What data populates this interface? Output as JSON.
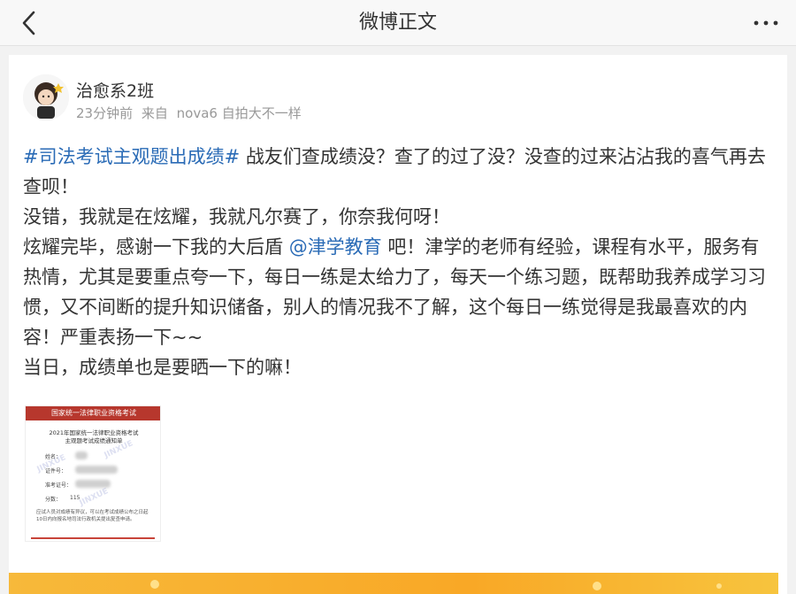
{
  "nav": {
    "title": "微博正文",
    "back_icon": "chevron-left-icon",
    "more_icon": "more-dots-icon"
  },
  "post": {
    "author": "治愈系2班",
    "time": "23分钟前",
    "source_prefix": "来自",
    "device": "nova6 自拍大不一样",
    "hashtag": "#司法考试主观题出成绩#",
    "line1_rest": " 战友们查成绩没？查了的过了没？没查的过来沾沾我的喜气再去查呗！",
    "line2": "没错，我就是在炫耀，我就凡尔赛了，你奈我何呀！",
    "line3_pre": "炫耀完毕，感谢一下我的大后盾 ",
    "mention": "@津学教育",
    "line3_post": " 吧！津学的老师有经验，课程有水平，服务有热情，尤其是要重点夸一下，每日一练是太给力了，每天一个练习题，既帮助我养成学习习惯，又不间断的提升知识储备，别人的情况我不了解，这个每日一练觉得是我最喜欢的内容！严重表扬一下~~",
    "line4": "当日，成绩单也是要晒一下的嘛！"
  },
  "image": {
    "header": "国家统一法律职业资格考试",
    "title1": "2021年国家统一法律职业资格考试",
    "title2": "主观题考试成绩通知单",
    "label_name": "姓名：",
    "label_id": "证件号：",
    "label_permit": "准考证号：",
    "label_score": "分数：",
    "score": "115",
    "watermark": "JINXUE",
    "note": "应试人员对成绩有异议，可以在考试成绩公布之日起10日内向报名地司法行政机关提出复查申请。"
  },
  "colors": {
    "link": "#2a6bb6",
    "meta": "#999999",
    "banner": "#f9a826"
  }
}
